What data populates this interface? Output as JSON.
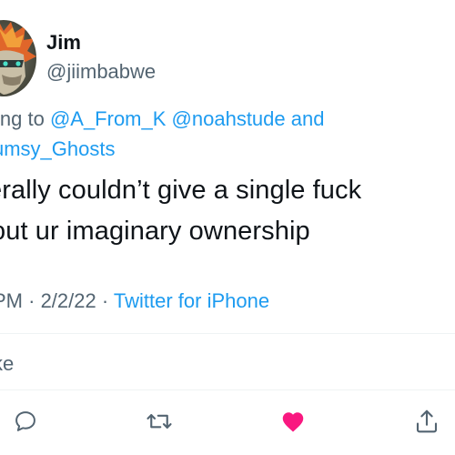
{
  "author": {
    "display_name": "Jim",
    "handle": "@jiimbabwe"
  },
  "reply": {
    "prefix": "ying to ",
    "mention_1": "@A_From_K",
    "mention_2": "@noahstude",
    "conjunction": "and",
    "mention_3": "umsy_Ghosts"
  },
  "tweet": {
    "line_1": "erally couldn’t give a single fuck",
    "line_2": "out ur imaginary ownership"
  },
  "meta": {
    "time_fragment": " PM · ",
    "date": "2/2/22",
    "separator": " · ",
    "source": "Twitter for iPhone"
  },
  "engagement": {
    "likes_label": "ke"
  },
  "actions": {
    "reply_icon": "comment-icon",
    "retweet_icon": "retweet-icon",
    "like_icon": "heart-filled-icon",
    "share_icon": "share-icon"
  },
  "colors": {
    "link": "#1d9bf0",
    "secondary_text": "#536471",
    "primary_text": "#0f1419",
    "like": "#f91880",
    "divider": "#eff3f4"
  }
}
